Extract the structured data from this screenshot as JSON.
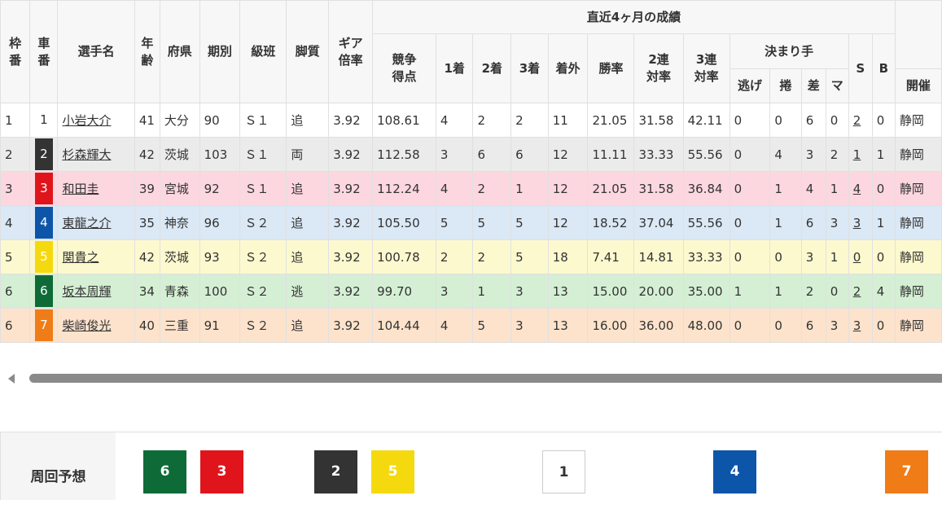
{
  "table": {
    "headers": {
      "waku": "枠\n番",
      "sha": "車\n番",
      "name": "選手名",
      "age": "年\n齢",
      "pref": "府県",
      "term": "期別",
      "class": "級班",
      "style": "脚質",
      "gear": "ギア\n倍率",
      "recent_group": "直近4ヶ月の成績",
      "score": "競争\n得点",
      "first": "1着",
      "second": "2着",
      "third": "3着",
      "out": "着外",
      "win_rate": "勝率",
      "quinella_rate": "2連\n対率",
      "trio_rate": "3連\n対率",
      "kimarite_group": "決まり手",
      "nige": "逃げ",
      "makuri": "捲",
      "sashi": "差",
      "mark": "マ",
      "s": "S",
      "b": "B",
      "venue": "開催"
    },
    "rows": [
      {
        "waku": "1",
        "sha": "1",
        "name": "小岩大介",
        "age": "41",
        "pref": "大分",
        "term": "90",
        "class": "Ｓ１",
        "style": "追",
        "gear": "3.92",
        "score": "108.61",
        "first": "4",
        "second": "2",
        "third": "2",
        "out": "11",
        "win_rate": "21.05",
        "quinella_rate": "31.58",
        "trio_rate": "42.11",
        "nige": "0",
        "makuri": "0",
        "sashi": "6",
        "mark": "0",
        "s": "2",
        "b": "0",
        "venue": "静岡"
      },
      {
        "waku": "2",
        "sha": "2",
        "name": "杉森輝大",
        "age": "42",
        "pref": "茨城",
        "term": "103",
        "class": "Ｓ１",
        "style": "両",
        "gear": "3.92",
        "score": "112.58",
        "first": "3",
        "second": "6",
        "third": "6",
        "out": "12",
        "win_rate": "11.11",
        "quinella_rate": "33.33",
        "trio_rate": "55.56",
        "nige": "0",
        "makuri": "4",
        "sashi": "3",
        "mark": "2",
        "s": "1",
        "b": "1",
        "venue": "静岡"
      },
      {
        "waku": "3",
        "sha": "3",
        "name": "和田圭",
        "age": "39",
        "pref": "宮城",
        "term": "92",
        "class": "Ｓ１",
        "style": "追",
        "gear": "3.92",
        "score": "112.24",
        "first": "4",
        "second": "2",
        "third": "1",
        "out": "12",
        "win_rate": "21.05",
        "quinella_rate": "31.58",
        "trio_rate": "36.84",
        "nige": "0",
        "makuri": "1",
        "sashi": "4",
        "mark": "1",
        "s": "4",
        "b": "0",
        "venue": "静岡"
      },
      {
        "waku": "4",
        "sha": "4",
        "name": "東龍之介",
        "age": "35",
        "pref": "神奈",
        "term": "96",
        "class": "Ｓ２",
        "style": "追",
        "gear": "3.92",
        "score": "105.50",
        "first": "5",
        "second": "5",
        "third": "5",
        "out": "12",
        "win_rate": "18.52",
        "quinella_rate": "37.04",
        "trio_rate": "55.56",
        "nige": "0",
        "makuri": "1",
        "sashi": "6",
        "mark": "3",
        "s": "3",
        "b": "1",
        "venue": "静岡"
      },
      {
        "waku": "5",
        "sha": "5",
        "name": "関貴之",
        "age": "42",
        "pref": "茨城",
        "term": "93",
        "class": "Ｓ２",
        "style": "追",
        "gear": "3.92",
        "score": "100.78",
        "first": "2",
        "second": "2",
        "third": "5",
        "out": "18",
        "win_rate": "7.41",
        "quinella_rate": "14.81",
        "trio_rate": "33.33",
        "nige": "0",
        "makuri": "0",
        "sashi": "3",
        "mark": "1",
        "s": "0",
        "b": "0",
        "venue": "静岡"
      },
      {
        "waku": "6",
        "sha": "6",
        "name": "坂本周輝",
        "age": "34",
        "pref": "青森",
        "term": "100",
        "class": "Ｓ２",
        "style": "逃",
        "gear": "3.92",
        "score": "99.70",
        "first": "3",
        "second": "1",
        "third": "3",
        "out": "13",
        "win_rate": "15.00",
        "quinella_rate": "20.00",
        "trio_rate": "35.00",
        "nige": "1",
        "makuri": "1",
        "sashi": "2",
        "mark": "0",
        "s": "2",
        "b": "4",
        "venue": "静岡"
      },
      {
        "waku": "6",
        "sha": "7",
        "name": "柴崎俊光",
        "age": "40",
        "pref": "三重",
        "term": "91",
        "class": "Ｓ２",
        "style": "追",
        "gear": "3.92",
        "score": "104.44",
        "first": "4",
        "second": "5",
        "third": "3",
        "out": "13",
        "win_rate": "16.00",
        "quinella_rate": "36.00",
        "trio_rate": "48.00",
        "nige": "0",
        "makuri": "0",
        "sashi": "6",
        "mark": "3",
        "s": "3",
        "b": "0",
        "venue": "静岡"
      }
    ]
  },
  "car_colors": {
    "1": {
      "bg": "#ffffff",
      "fg": "#333333"
    },
    "2": {
      "bg": "#333333",
      "fg": "#ffffff"
    },
    "3": {
      "bg": "#e0151c",
      "fg": "#ffffff"
    },
    "4": {
      "bg": "#0d55a8",
      "fg": "#ffffff"
    },
    "5": {
      "bg": "#f5d90f",
      "fg": "#ffffff"
    },
    "6": {
      "bg": "#0e6b38",
      "fg": "#ffffff"
    },
    "7": {
      "bg": "#f07c18",
      "fg": "#ffffff"
    }
  },
  "prediction": {
    "label": "周回予想",
    "order": [
      "6",
      "3",
      "2",
      "5",
      "1",
      "4",
      "7"
    ]
  }
}
